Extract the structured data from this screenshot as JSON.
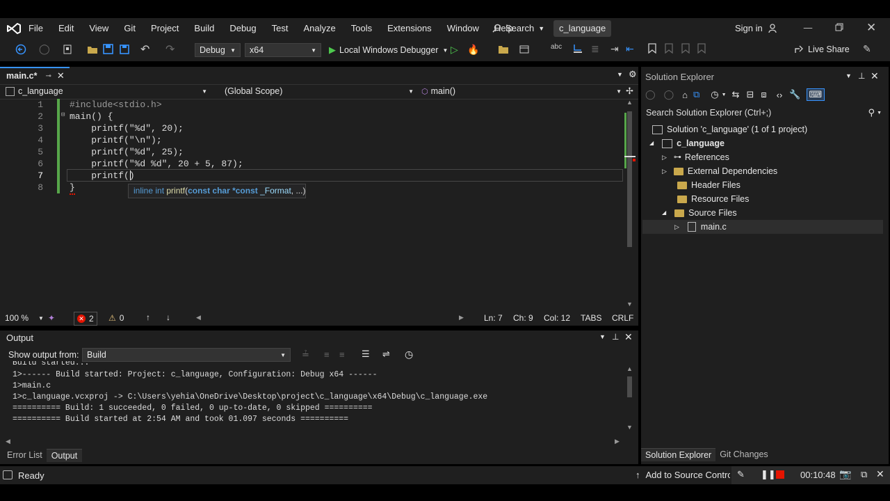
{
  "menu": {
    "items": [
      "File",
      "Edit",
      "View",
      "Git",
      "Project",
      "Build",
      "Debug",
      "Test",
      "Analyze",
      "Tools",
      "Extensions",
      "Window",
      "Help"
    ],
    "search_label": "Search",
    "solution_name": "c_language",
    "sign_in": "Sign in"
  },
  "toolbar": {
    "config": "Debug",
    "platform": "x64",
    "debugger": "Local Windows Debugger",
    "live_share": "Live Share"
  },
  "editor": {
    "tab_label": "main.c*",
    "nav_project": "c_language",
    "nav_scope": "(Global Scope)",
    "nav_member": "main()",
    "line_numbers": [
      "1",
      "2",
      "3",
      "4",
      "5",
      "6",
      "7",
      "8"
    ],
    "lines": [
      "#include<stdio.h>",
      "main() {",
      "    printf(\"%d\", 20);",
      "    printf(\"\\n\");",
      "    printf(\"%d\", 25);",
      "    printf(\"%d %d\", 20 + 5, 87);",
      "    printf()",
      "}"
    ],
    "tooltip": {
      "prefix": "inline int ",
      "fn": "printf",
      "open": "(",
      "param1_type": "const char *const",
      "param1_name": " _Format",
      "rest": ", ...)"
    },
    "status": {
      "zoom": "100 %",
      "errors": "2",
      "warnings": "0",
      "ln": "Ln: 7",
      "ch": "Ch: 9",
      "col": "Col: 12",
      "tabs": "TABS",
      "eol": "CRLF"
    }
  },
  "output": {
    "title": "Output",
    "show_from_label": "Show output from:",
    "source": "Build",
    "lines": [
      "Build started...",
      "1>------ Build started: Project: c_language, Configuration: Debug x64 ------",
      "1>main.c",
      "1>c_language.vcxproj -> C:\\Users\\yehia\\OneDrive\\Desktop\\project\\c_language\\x64\\Debug\\c_language.exe",
      "========== Build: 1 succeeded, 0 failed, 0 up-to-date, 0 skipped ==========",
      "========== Build started at 2:54 AM and took 01.097 seconds =========="
    ],
    "tabs": [
      "Error List",
      "Output"
    ]
  },
  "solution_explorer": {
    "title": "Solution Explorer",
    "search_placeholder": "Search Solution Explorer (Ctrl+;)",
    "solution": "Solution 'c_language' (1 of 1 project)",
    "project": "c_language",
    "items": [
      "References",
      "External Dependencies",
      "Header Files",
      "Resource Files",
      "Source Files",
      "main.c"
    ],
    "bottom_tabs": [
      "Solution Explorer",
      "Git Changes"
    ]
  },
  "statusbar": {
    "ready": "Ready",
    "source_control": "Add to Source Control",
    "timer": "00:10:48"
  },
  "colors": {
    "accent": "#3794ff",
    "keyword": "#569cd6",
    "string": "#d69d85",
    "fn": "#dcdcaa",
    "error": "#e51400",
    "play": "#4ec94e"
  }
}
